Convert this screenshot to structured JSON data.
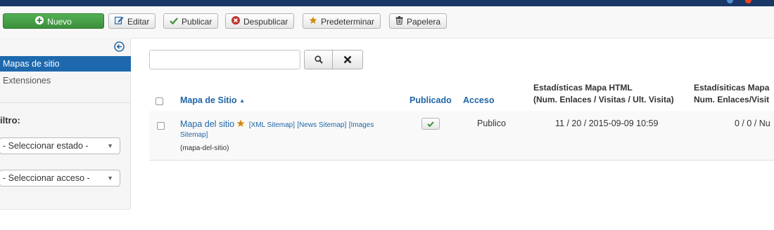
{
  "toolbar": {
    "new_label": "Nuevo",
    "edit_label": "Editar",
    "publish_label": "Publicar",
    "unpublish_label": "Despublicar",
    "default_label": "Predeterminar",
    "trash_label": "Papelera"
  },
  "sidebar": {
    "items": [
      {
        "label": "Mapas de sitio",
        "active": true
      },
      {
        "label": "Extensiones",
        "active": false
      }
    ],
    "filter_title": "iltro:",
    "state_select": "- Seleccionar estado -",
    "access_select": "- Seleccionar acceso -"
  },
  "search": {
    "value": ""
  },
  "table": {
    "headers": {
      "name": "Mapa de Sitio",
      "published": "Publicado",
      "access": "Acceso",
      "html_stats_line1": "Estadísticas Mapa HTML",
      "html_stats_line2": "(Num. Enlaces / Visitas / Ult. Visita)",
      "xml_stats_line1": "Estadísiticas Mapa",
      "xml_stats_line2": "Num. Enlaces/Visit"
    },
    "rows": [
      {
        "name": "Mapa del sitio",
        "links": [
          "[XML Sitemap]",
          "[News Sitemap]",
          "[Images",
          "Sitemap]"
        ],
        "alias": "(mapa-del-sitio)",
        "published": true,
        "access": "Publico",
        "html_stats": "11 / 20 / 2015-09-09 10:59",
        "xml_stats": "0 / 0 / Nu"
      }
    ]
  },
  "colors": {
    "topbar": "#1a3867",
    "new_button": "#46a546",
    "active_sidebar": "#1e69ae",
    "link": "#1f65a7",
    "star": "#d18a0f"
  }
}
